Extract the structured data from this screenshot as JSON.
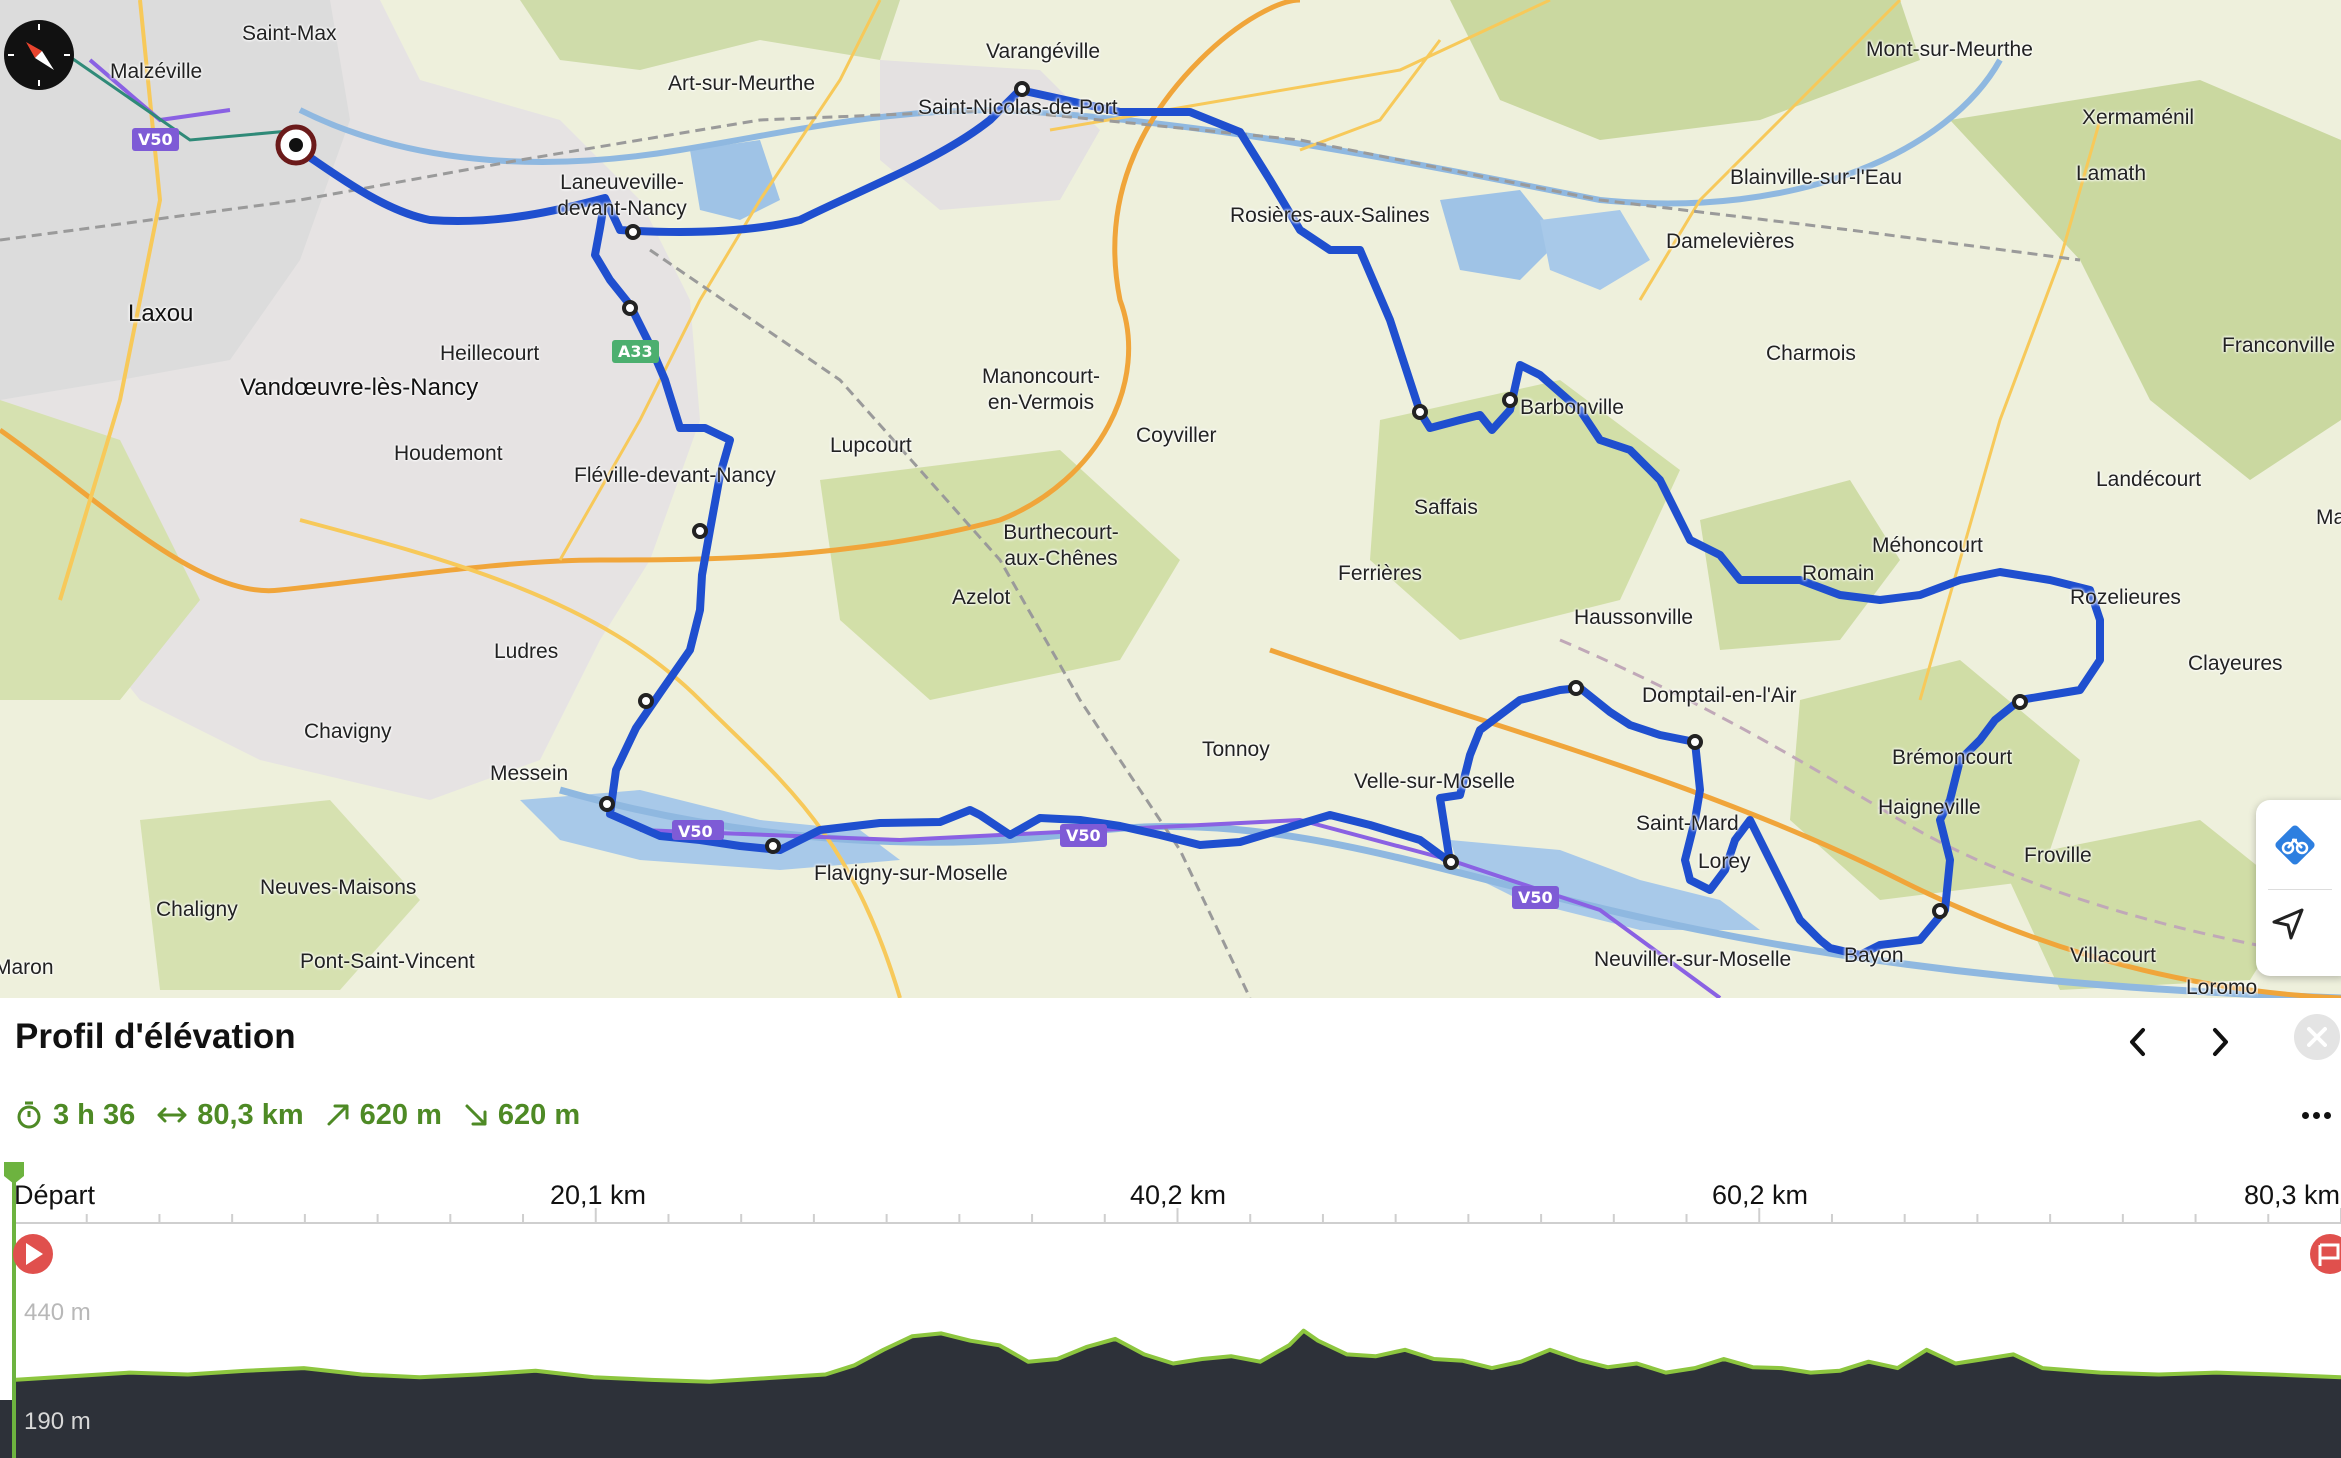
{
  "map": {
    "places": [
      {
        "name": "Saint-Max"
      },
      {
        "name": "Malzéville"
      },
      {
        "name": "Art-sur-Meurthe"
      },
      {
        "name": "Varangéville"
      },
      {
        "name": "Mont-sur-Meurthe"
      },
      {
        "name": "Xermaménil"
      },
      {
        "name": "Lamath"
      },
      {
        "name": "Blainville-sur-l'Eau"
      },
      {
        "name": "Damelevières"
      },
      {
        "name": "Laneuveville-devant-Nancy"
      },
      {
        "name": "Saint-Nicolas-de-Port"
      },
      {
        "name": "Rosières-aux-Salines"
      },
      {
        "name": "Laxou"
      },
      {
        "name": "Heillecourt"
      },
      {
        "name": "Vandœuvre-lès-Nancy"
      },
      {
        "name": "Houdemont"
      },
      {
        "name": "Fléville-devant-Nancy"
      },
      {
        "name": "Lupcourt"
      },
      {
        "name": "Manoncourt-en-Vermois"
      },
      {
        "name": "Coyviller"
      },
      {
        "name": "Saffais"
      },
      {
        "name": "Barbonville"
      },
      {
        "name": "Charmois"
      },
      {
        "name": "Franconville"
      },
      {
        "name": "Landécourt"
      },
      {
        "name": "Méhoncourt"
      },
      {
        "name": "Romain"
      },
      {
        "name": "Rozelieures"
      },
      {
        "name": "Burthecourt-aux-Chênes"
      },
      {
        "name": "Azelot"
      },
      {
        "name": "Ferrières"
      },
      {
        "name": "Haussonville"
      },
      {
        "name": "Clayeures"
      },
      {
        "name": "Ludres"
      },
      {
        "name": "Chavigny"
      },
      {
        "name": "Messein"
      },
      {
        "name": "Tonnoy"
      },
      {
        "name": "Velle-sur-Moselle"
      },
      {
        "name": "Domptail-en-l'Air"
      },
      {
        "name": "Brémoncourt"
      },
      {
        "name": "Haigneville"
      },
      {
        "name": "Froville"
      },
      {
        "name": "Saint-Mard"
      },
      {
        "name": "Lorey"
      },
      {
        "name": "Chaligny"
      },
      {
        "name": "Neuves-Maisons"
      },
      {
        "name": "Flavigny-sur-Moselle"
      },
      {
        "name": "Pont-Saint-Vincent"
      },
      {
        "name": "Neuviller-sur-Moselle"
      },
      {
        "name": "Bayon"
      },
      {
        "name": "Villacourt"
      },
      {
        "name": "Loromontzey"
      },
      {
        "name": "Maron"
      },
      {
        "name": "Mangonville"
      }
    ],
    "road_badges": [
      "V50",
      "V50",
      "V50",
      "A33",
      "V50"
    ],
    "controls": {
      "bike_icon": "bike-route-icon",
      "locate_icon": "locate-arrow-icon",
      "compass_icon": "compass-icon"
    },
    "route_color": "#1f4fcf"
  },
  "panel": {
    "title": "Profil d'élévation",
    "stats": {
      "duration": "3 h 36",
      "distance": "80,3 km",
      "ascent": "620 m",
      "descent": "620 m"
    },
    "stat_color": "#4e8a25"
  },
  "chart_data": {
    "type": "area",
    "title": "Profil d'élévation",
    "xlabel": "",
    "ylabel": "",
    "x_tick_labels": [
      "Départ",
      "20,1 km",
      "40,2 km",
      "60,2 km",
      "80,3 km"
    ],
    "y_tick_labels": [
      "440 m",
      "190 m"
    ],
    "xlim": [
      0,
      80.3
    ],
    "ylim": [
      190,
      440
    ],
    "series": [
      {
        "x": [
          0,
          2,
          4,
          6,
          8,
          10,
          12,
          14,
          16,
          18,
          20,
          22,
          24,
          26,
          28,
          29,
          30,
          31,
          32,
          33,
          34,
          35,
          36,
          37,
          38,
          39,
          40,
          41,
          42,
          43,
          44,
          44.5,
          45,
          46,
          47,
          48,
          49,
          50,
          51,
          52,
          53,
          54,
          55,
          56,
          57,
          58,
          59,
          60,
          61,
          62,
          63,
          64,
          65,
          66,
          67,
          68,
          69,
          70,
          72,
          74,
          76,
          78,
          80.3
        ],
        "y": [
          212,
          216,
          220,
          218,
          222,
          225,
          218,
          215,
          218,
          222,
          215,
          212,
          210,
          214,
          218,
          228,
          245,
          260,
          263,
          255,
          250,
          232,
          235,
          248,
          257,
          240,
          230,
          235,
          238,
          232,
          250,
          266,
          255,
          240,
          238,
          245,
          235,
          233,
          225,
          232,
          245,
          234,
          226,
          230,
          220,
          225,
          235,
          226,
          225,
          220,
          222,
          232,
          225,
          245,
          230,
          235,
          240,
          225,
          220,
          218,
          220,
          218,
          215
        ]
      }
    ],
    "colors": {
      "line": "#8dc63f",
      "fill": "#2d3139",
      "peak": "#c9663e"
    }
  }
}
